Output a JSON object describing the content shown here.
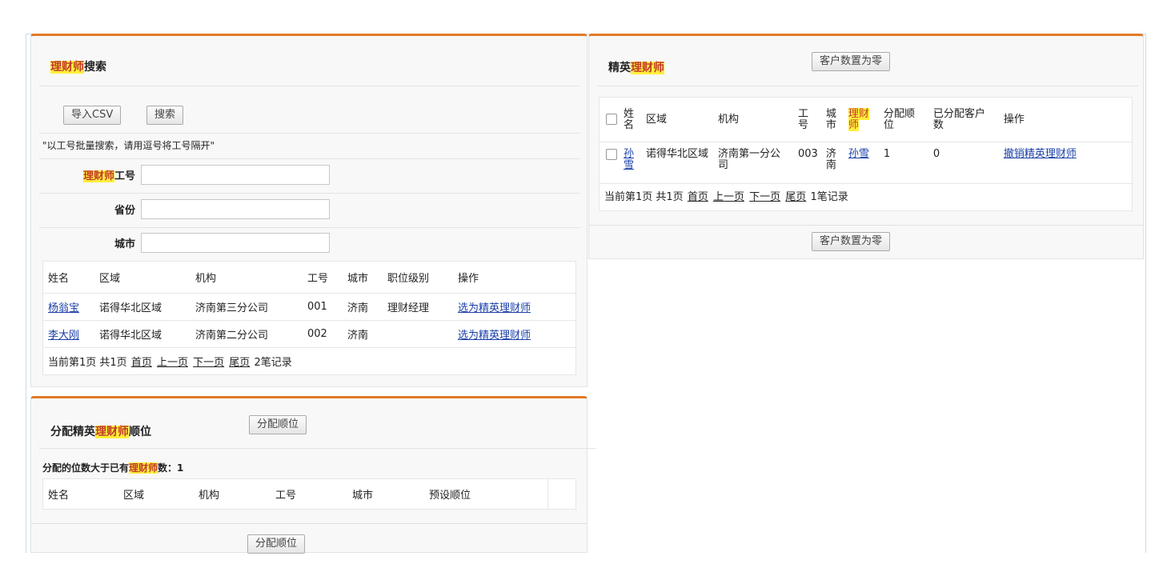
{
  "search_panel": {
    "title_hl": "理财师",
    "title_rest": "搜索",
    "import_csv_label": "导入CSV",
    "search_label": "搜索",
    "hint": "\"以工号批量搜索，请用逗号将工号隔开\"",
    "field_id": {
      "hl": "理财师",
      "rest": "工号",
      "value": ""
    },
    "field_province": {
      "label": "省份",
      "value": ""
    },
    "field_city": {
      "label": "城市",
      "value": ""
    },
    "table": {
      "headers": [
        "姓名",
        "区域",
        "机构",
        "工号",
        "城市",
        "职位级别",
        "操作"
      ],
      "rows": [
        {
          "name": "杨翁宝",
          "region": "诺得华北区域",
          "org": "济南第三分公司",
          "id": "001",
          "city": "济南",
          "level": "理财经理",
          "action": "选为精英理财师"
        },
        {
          "name": "李大刚",
          "region": "诺得华北区域",
          "org": "济南第二分公司",
          "id": "002",
          "city": "济南",
          "level": "",
          "action": "选为精英理财师"
        }
      ],
      "pager": {
        "pre": "当前第1页 共1页",
        "first": "首页",
        "prev": "上一页",
        "next": "下一页",
        "last": "尾页",
        "count": "2笔记录"
      }
    }
  },
  "assign_panel": {
    "title_pre": "分配精英",
    "title_hl": "理财师",
    "title_post": "顺位",
    "assign_button": "分配顺位",
    "info_pre": "分配的位数大于已有",
    "info_hl": "理财师",
    "info_post": "数：1",
    "table_headers": [
      "姓名",
      "区域",
      "机构",
      "工号",
      "城市",
      "预设顺位",
      ""
    ],
    "bottom_button": "分配顺位"
  },
  "elite_panel": {
    "title_pre": "精英",
    "title_hl": "理财师",
    "zero_button": "客户数置为零",
    "headers": {
      "name": "姓名",
      "region": "区域",
      "org": "机构",
      "id": "工号",
      "city": "城市",
      "advisor": "理财师",
      "order": "分配顺位",
      "assigned": "已分配客户数",
      "action": "操作"
    },
    "rows": [
      {
        "name": "孙雪",
        "region": "诺得华北区域",
        "org": "济南第一分公司",
        "id": "003",
        "city": "济南",
        "advisor": "孙雪",
        "order": "1",
        "assigned": "0",
        "action": "撤销精英理财师"
      }
    ],
    "pager": {
      "pre": "当前第1页 共1页",
      "first": "首页",
      "prev": "上一页",
      "next": "下一页",
      "last": "尾页",
      "count": "1笔记录"
    },
    "bottom_button": "客户数置为零"
  },
  "colors": {
    "accent": "#e07b28",
    "highlight": "#ffef3a",
    "link": "#1a3fa8"
  }
}
